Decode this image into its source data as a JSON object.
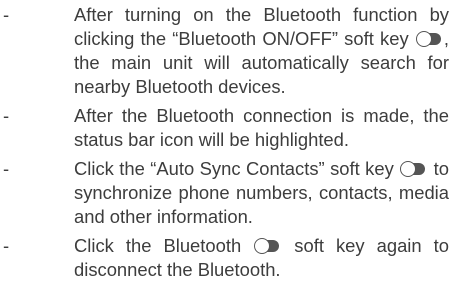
{
  "bullet": "-",
  "items": [
    {
      "before": "After turning on the Bluetooth function by clicking the “Bluetooth ON/OFF” soft key",
      "after": ", the main unit will automatically search for nearby Bluetooth devices."
    },
    {
      "text": "After the Bluetooth connection is made, the status bar icon will be highlighted."
    },
    {
      "before": "Click the “Auto Sync Contacts” soft key",
      "after": "to synchronize phone numbers, contacts, media and other information."
    },
    {
      "before": "Click the Bluetooth",
      "after": "soft key again to disconnect the Bluetooth."
    }
  ],
  "icons": {
    "toggle": "toggle-switch-icon"
  },
  "colors": {
    "text": "#3d3d3d",
    "icon": "#555555"
  }
}
